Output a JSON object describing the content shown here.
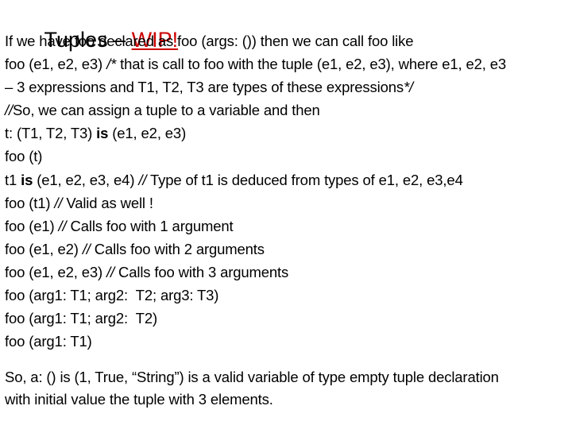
{
  "slide": {
    "title": {
      "main_text": "Tuples – ",
      "accent_text": "WIP!",
      "accent_color": "#cc0000"
    },
    "body_lines": [
      {
        "id": "line-1",
        "segments": [
          {
            "text": "If we have foo declared as foo (args: ()) then we can call foo like",
            "style": "normal"
          }
        ]
      },
      {
        "id": "line-2",
        "segments": [
          {
            "text": "foo (e1, e2, e3) ",
            "style": "normal"
          },
          {
            "text": "/*",
            "style": "italic"
          },
          {
            "text": " that is call to foo with the tuple (e1, e2, e3), where e1, e2, e3",
            "style": "normal"
          }
        ]
      },
      {
        "id": "line-3",
        "segments": [
          {
            "text": "– 3 expressions and T1, T2, T3 are types of these expressions",
            "style": "normal"
          },
          {
            "text": "*/",
            "style": "italic"
          }
        ]
      },
      {
        "id": "line-4",
        "segments": [
          {
            "text": "//",
            "style": "italic"
          },
          {
            "text": "So, we can assign a tuple to a variable and then",
            "style": "normal"
          }
        ]
      },
      {
        "id": "line-5",
        "segments": [
          {
            "text": "t: (T1, T2, T3) ",
            "style": "normal"
          },
          {
            "text": "is",
            "style": "bold"
          },
          {
            "text": " (e1, e2, e3)",
            "style": "normal"
          }
        ]
      },
      {
        "id": "line-6",
        "segments": [
          {
            "text": "foo (t)",
            "style": "normal"
          }
        ]
      },
      {
        "id": "line-7",
        "segments": [
          {
            "text": "t1 ",
            "style": "normal"
          },
          {
            "text": "is",
            "style": "bold"
          },
          {
            "text": " (e1, e2, e3, e4) ",
            "style": "normal"
          },
          {
            "text": "//",
            "style": "italic"
          },
          {
            "text": " Type of t1 is deduced from types of e1, e2, e3,e4",
            "style": "normal"
          }
        ]
      },
      {
        "id": "line-8",
        "segments": [
          {
            "text": "foo (t1) ",
            "style": "normal"
          },
          {
            "text": "//",
            "style": "italic"
          },
          {
            "text": " Valid as well !",
            "style": "normal"
          }
        ]
      },
      {
        "id": "line-9",
        "segments": [
          {
            "text": "foo (e1) ",
            "style": "normal"
          },
          {
            "text": "//",
            "style": "italic"
          },
          {
            "text": " Calls foo with 1 argument",
            "style": "normal"
          }
        ]
      },
      {
        "id": "line-10",
        "segments": [
          {
            "text": "foo (e1, e2) ",
            "style": "normal"
          },
          {
            "text": "//",
            "style": "italic"
          },
          {
            "text": " Calls foo with 2 arguments",
            "style": "normal"
          }
        ]
      },
      {
        "id": "line-11",
        "segments": [
          {
            "text": "foo (e1, e2, e3) ",
            "style": "normal"
          },
          {
            "text": "//",
            "style": "italic"
          },
          {
            "text": " Calls foo with 3 arguments",
            "style": "normal"
          }
        ]
      },
      {
        "id": "line-12",
        "segments": [
          {
            "text": "foo (arg1: T1; arg2:  T2; arg3: T3)",
            "style": "normal"
          }
        ]
      },
      {
        "id": "line-13",
        "segments": [
          {
            "text": "foo (arg1: T1; arg2:  T2)",
            "style": "normal"
          }
        ]
      },
      {
        "id": "line-14",
        "segments": [
          {
            "text": "foo (arg1: T1)",
            "style": "normal"
          }
        ]
      }
    ],
    "closing_lines": [
      {
        "id": "closing-1",
        "text": "So, a: () is (1, True, “String”) is a valid variable of type empty tuple declaration"
      },
      {
        "id": "closing-2",
        "text": "with initial value the tuple with 3 elements."
      }
    ]
  }
}
